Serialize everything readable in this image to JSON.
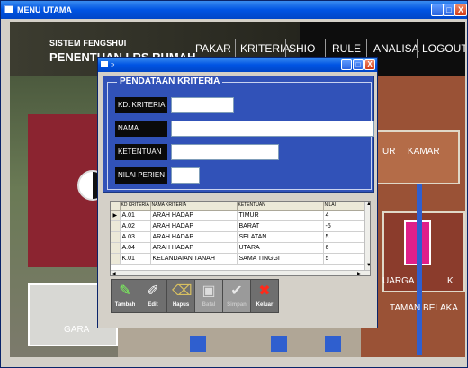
{
  "window": {
    "title": "MENU UTAMA",
    "min": "_",
    "max": "□",
    "close": "X"
  },
  "app": {
    "system_title": "SISTEM FENGSHUI",
    "system_subtitle": "PENENTUAN LRS RUMAH",
    "nav": [
      "PAKAR",
      "KRITERIA",
      "SHIO",
      "RULE",
      "ANALISA",
      "LOGOUT"
    ]
  },
  "background": {
    "labels": [
      "UR",
      "KAMAR",
      "UARGA",
      "K",
      "TAMAN BELAKA",
      "GARA"
    ]
  },
  "dialog": {
    "title": "»",
    "group_title": "PENDATAAN KRITERIA",
    "fields": [
      {
        "label": "KD. KRITERIA",
        "value": ""
      },
      {
        "label": "NAMA",
        "value": ""
      },
      {
        "label": "KETENTUAN",
        "value": ""
      },
      {
        "label": "NILAI PERIEN",
        "value": ""
      }
    ],
    "grid": {
      "columns": [
        "KD KRITERIA",
        "NAMA KRITERIA",
        "KETENTUAN",
        "NILAI"
      ],
      "rows": [
        [
          "A.01",
          "ARAH HADAP",
          "TIMUR",
          "4"
        ],
        [
          "A.02",
          "ARAH HADAP",
          "BARAT",
          "-5"
        ],
        [
          "A.03",
          "ARAH HADAP",
          "SELATAN",
          "5"
        ],
        [
          "A.04",
          "ARAH HADAP",
          "UTARA",
          "6"
        ],
        [
          "K.01",
          "KELANDAIAN TANAH",
          "SAMA TINGGI",
          "5"
        ]
      ],
      "selected_row": 0
    },
    "toolbar": [
      {
        "label": "Tambah",
        "icon": "pen-icon",
        "enabled": true
      },
      {
        "label": "Edit",
        "icon": "edit-icon",
        "enabled": true
      },
      {
        "label": "Hapus",
        "icon": "delete-icon",
        "enabled": true
      },
      {
        "label": "Batal",
        "icon": "cancel-icon",
        "enabled": false
      },
      {
        "label": "Simpan",
        "icon": "checkmark-icon",
        "enabled": false
      },
      {
        "label": "Keluar",
        "icon": "close-x-icon",
        "enabled": true
      }
    ]
  }
}
